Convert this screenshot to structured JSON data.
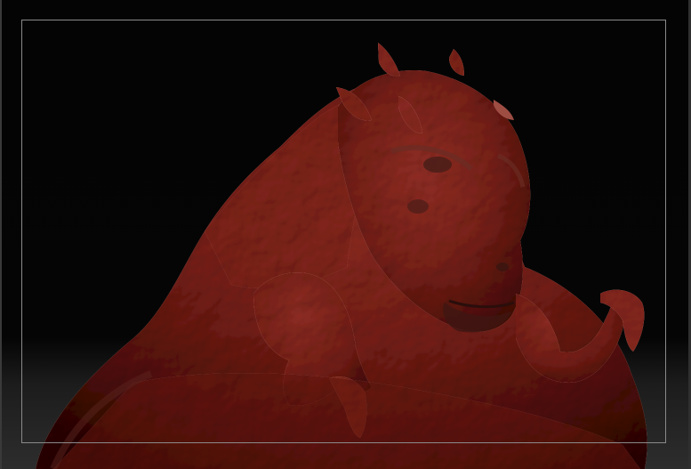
{
  "app": {
    "view": "3d-viewport",
    "material_color": "#9a4a3f",
    "background_color": "#050505",
    "frame_color": "#8a8a8a"
  }
}
